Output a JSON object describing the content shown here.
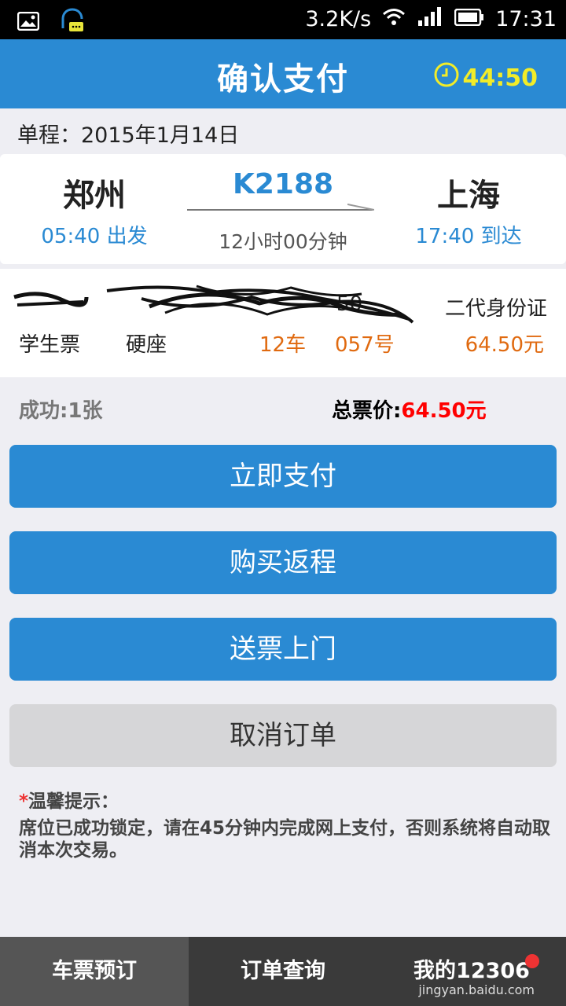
{
  "status_bar": {
    "speed": "3.2K/s",
    "time": "17:31"
  },
  "header": {
    "title": "确认支付",
    "countdown": "44:50"
  },
  "trip": {
    "date_label": "单程：2015年1月14日",
    "from_station": "郑州",
    "departure": "05:40 出发",
    "train_number": "K2188",
    "duration": "12小时00分钟",
    "to_station": "上海",
    "arrival": "17:40 到达"
  },
  "passenger": {
    "id_type": "二代身份证",
    "ticket_type": "学生票",
    "seat_class": "硬座",
    "car": "12车",
    "seat_no": "057号",
    "price": "64.50元",
    "redacted_tail": "50"
  },
  "summary": {
    "success": "成功:1张",
    "total_label": "总票价:",
    "total_value": "64.50元"
  },
  "buttons": {
    "pay": "立即支付",
    "return_trip": "购买返程",
    "delivery": "送票上门",
    "cancel": "取消订单"
  },
  "tips": {
    "title": "温馨提示：",
    "body": "席位已成功锁定，请在45分钟内完成网上支付，否则系统将自动取消本次交易。"
  },
  "tabs": [
    "车票预订",
    "订单查询",
    "我的12306"
  ],
  "watermark": "jingyan.baidu.com",
  "colors": {
    "primary": "#2a8ad3",
    "timer": "#f2ec28",
    "accent_orange": "#e06a10",
    "price_red": "#ff0000"
  }
}
